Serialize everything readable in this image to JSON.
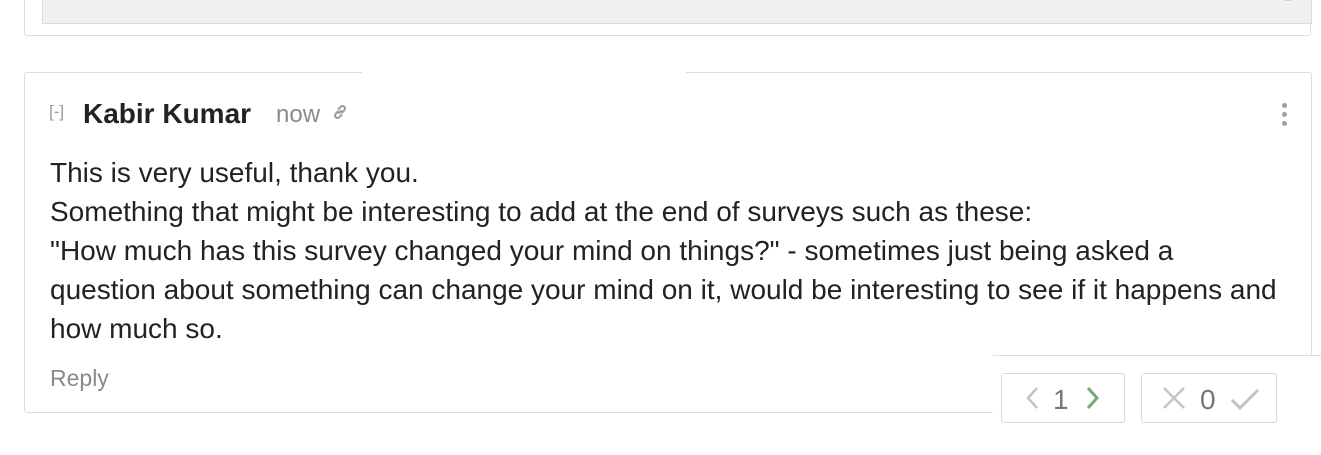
{
  "comment": {
    "collapse_label": "[-]",
    "author": "Kabir Kumar",
    "time": "now",
    "body": [
      "This is very useful, thank you.",
      "Something that might be interesting to add at the end of surveys such as these:",
      "\"How much has this survey changed your mind on things?\" - sometimes just being asked a question about something can change your mind on it, would be interesting to see if it happens and how much so."
    ],
    "reply_label": "Reply",
    "karma_score": "1",
    "agreement_score": "0"
  },
  "colors": {
    "border": "#dddddd",
    "muted_text": "#8a8a8a",
    "upvote_active": "#75a77a"
  },
  "icons": [
    "link-icon",
    "more-options-icon",
    "chevron-left-icon",
    "chevron-right-icon",
    "cross-icon",
    "check-icon"
  ]
}
